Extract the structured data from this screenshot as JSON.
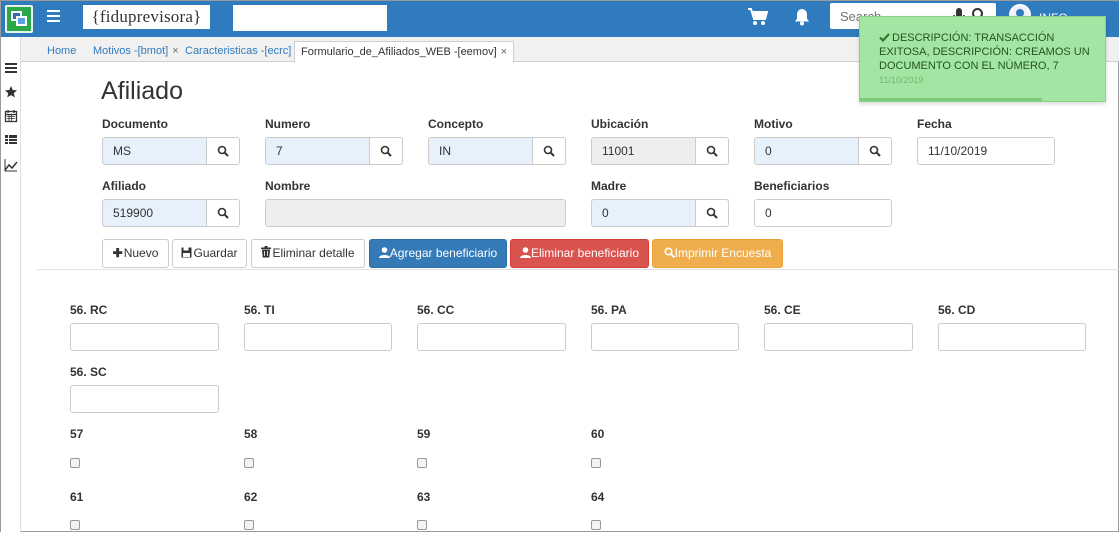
{
  "app": {
    "logo_text": "{fiduprevisora}",
    "search_placeholder": "Search",
    "user_label": "INFO"
  },
  "tabs": [
    {
      "label": "Home",
      "closable": false
    },
    {
      "label": "Motivos -[bmot]",
      "closable": true
    },
    {
      "label": "Caracteristicas -[ecrc]",
      "closable": true
    },
    {
      "label": "Formulario_de_Afiliados_WEB -[eemov]",
      "closable": true,
      "active": true
    }
  ],
  "form": {
    "title": "Afiliado",
    "documento": {
      "label": "Documento",
      "value": "MS"
    },
    "numero": {
      "label": "Numero",
      "value": "7"
    },
    "concepto": {
      "label": "Concepto",
      "value": "IN"
    },
    "ubicacion": {
      "label": "Ubicación",
      "value": "11001"
    },
    "motivo": {
      "label": "Motivo",
      "value": "0"
    },
    "fecha": {
      "label": "Fecha",
      "value": "11/10/2019"
    },
    "afiliado": {
      "label": "Afiliado",
      "value": "519900"
    },
    "nombre": {
      "label": "Nombre",
      "value": ""
    },
    "madre": {
      "label": "Madre",
      "value": "0"
    },
    "beneficiarios": {
      "label": "Beneficiarios",
      "value": "0"
    }
  },
  "actions": {
    "nuevo": "Nuevo",
    "guardar": "Guardar",
    "eliminar_detalle": "Eliminar detalle",
    "agregar_beneficiario": "Agregar beneficiario",
    "eliminar_beneficiario": "Eliminar beneficiario",
    "imprimir_encuesta": "Imprimir Encuesta"
  },
  "survey": {
    "text_fields": [
      {
        "label": "56. RC",
        "value": ""
      },
      {
        "label": "56. TI",
        "value": ""
      },
      {
        "label": "56. CC",
        "value": ""
      },
      {
        "label": "56. PA",
        "value": ""
      },
      {
        "label": "56. CE",
        "value": ""
      },
      {
        "label": "56. CD",
        "value": ""
      },
      {
        "label": "56. SC",
        "value": ""
      }
    ],
    "checkboxes": [
      {
        "label": "57",
        "checked": false
      },
      {
        "label": "58",
        "checked": false
      },
      {
        "label": "59",
        "checked": false
      },
      {
        "label": "60",
        "checked": false
      },
      {
        "label": "61",
        "checked": false
      },
      {
        "label": "62",
        "checked": false
      },
      {
        "label": "63",
        "checked": false
      },
      {
        "label": "64",
        "checked": false
      }
    ]
  },
  "toast": {
    "message": "DESCRIPCIÓN: TRANSACCIÓN EXITOSA, DESCRIPCIÓN: CREAMOS UN DOCUMENTO CON EL NÚMERO, 7",
    "date": "11/10/2019"
  },
  "colors": {
    "topbar": "#2f7bbd",
    "primary": "#337ab7",
    "danger": "#d9534f",
    "warning": "#f0ad4e",
    "toast": "#a3e6a3"
  }
}
